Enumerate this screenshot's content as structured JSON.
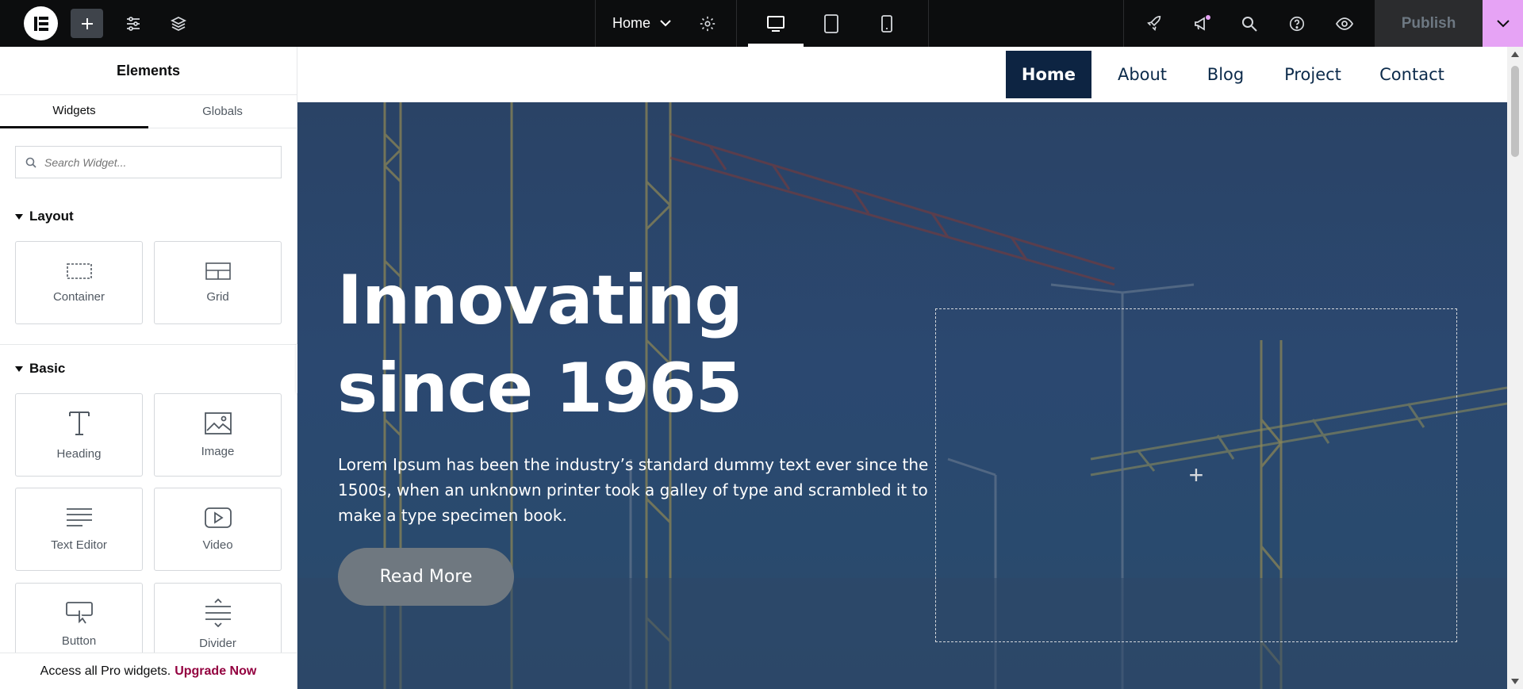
{
  "topbar": {
    "page_name": "Home",
    "publish_label": "Publish"
  },
  "sidebar": {
    "title": "Elements",
    "tabs": [
      "Widgets",
      "Globals"
    ],
    "search_placeholder": "Search Widget...",
    "categories": [
      {
        "label": "Layout",
        "widgets": [
          "Container",
          "Grid"
        ]
      },
      {
        "label": "Basic",
        "widgets": [
          "Heading",
          "Image",
          "Text Editor",
          "Video",
          "Button",
          "Divider"
        ]
      }
    ],
    "promo_text": "Access all Pro widgets.",
    "promo_link": "Upgrade Now"
  },
  "canvas": {
    "nav": [
      "Home",
      "About",
      "Blog",
      "Project",
      "Contact"
    ],
    "hero": {
      "title_line1": "Innovating",
      "title_line2": "since 1965",
      "text": "Lorem Ipsum has been the industry’s standard dummy text ever since the 1500s, when an unknown printer took a galley of type and scrambled it to make a type specimen book.",
      "button": "Read More"
    }
  },
  "colors": {
    "topbar_bg": "#0c0d0e",
    "accent_pink": "#e6a3f5",
    "nav_active_bg": "#0d2442",
    "promo_link": "#93003f"
  }
}
